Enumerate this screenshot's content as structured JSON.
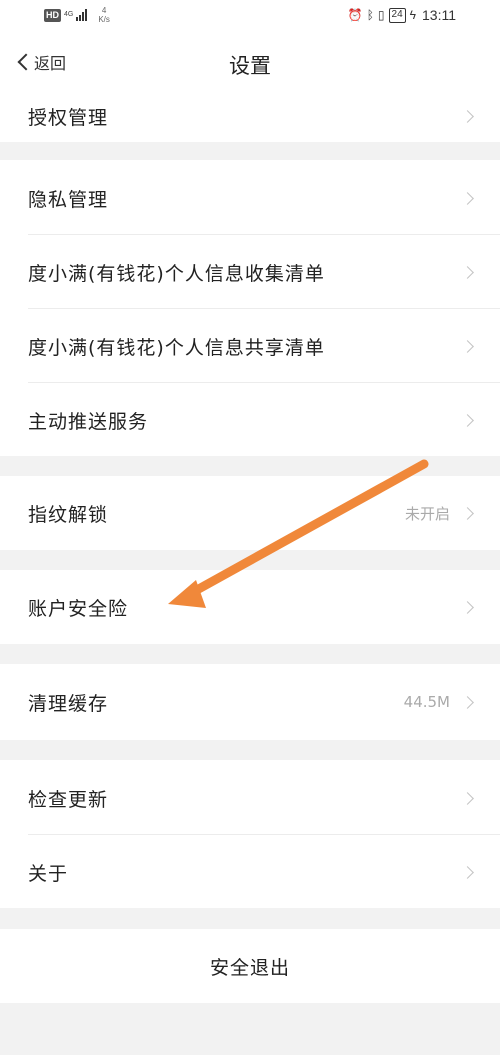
{
  "status_bar": {
    "hd": "HD",
    "network": "4G",
    "speed_value": "4",
    "speed_unit": "K/s",
    "battery": "24",
    "time": "13:11"
  },
  "nav": {
    "back_label": "返回",
    "title": "设置"
  },
  "groups": [
    {
      "items": [
        {
          "label": "授权管理"
        }
      ]
    },
    {
      "items": [
        {
          "label": "隐私管理"
        },
        {
          "label": "度小满(有钱花)个人信息收集清单"
        },
        {
          "label": "度小满(有钱花)个人信息共享清单"
        },
        {
          "label": "主动推送服务"
        }
      ]
    },
    {
      "items": [
        {
          "label": "指纹解锁",
          "value": "未开启"
        }
      ]
    },
    {
      "items": [
        {
          "label": "账户安全险"
        }
      ]
    },
    {
      "items": [
        {
          "label": "清理缓存",
          "value": "44.5M"
        }
      ]
    },
    {
      "items": [
        {
          "label": "检查更新"
        },
        {
          "label": "关于"
        }
      ]
    }
  ],
  "logout_label": "安全退出",
  "annotation": {
    "arrow_color": "#f0883a"
  }
}
